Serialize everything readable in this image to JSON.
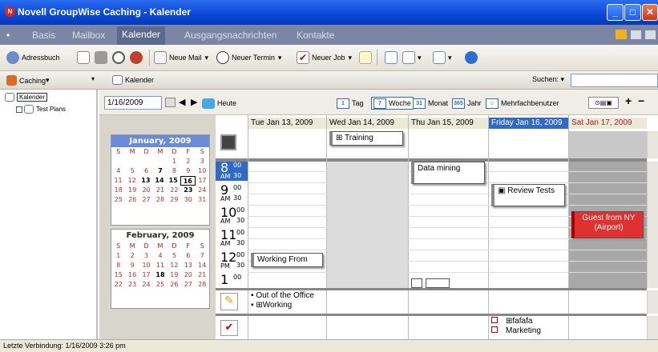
{
  "window": {
    "title": "Novell GroupWise Caching - Kalender"
  },
  "tabs": [
    {
      "label": "Basis"
    },
    {
      "label": "Mailbox"
    },
    {
      "label": "Kalender"
    },
    {
      "label": "Ausgangsnachrichten"
    },
    {
      "label": "Kontakte"
    }
  ],
  "toolbar": {
    "adressbuch": "Adressbuch",
    "neue_mail": "Neue Mail",
    "neuer_termin": "Neuer Termin",
    "neuer_job": "Neuer Job"
  },
  "subbar": {
    "caching": "Caching",
    "kalender": "Kalender",
    "suchen": "Suchen:"
  },
  "folders": {
    "root": "Kalender",
    "child": "Test Plans"
  },
  "calendar_header": {
    "date": "1/16/2009",
    "heute": "Heute",
    "views": [
      {
        "num": "1",
        "label": "Tag"
      },
      {
        "num": "7",
        "label": "Woche"
      },
      {
        "num": "31",
        "label": "Monat"
      },
      {
        "num": "365",
        "label": "Jahr"
      },
      {
        "num": "",
        "label": "Mehrfachbenutzer"
      }
    ]
  },
  "minicals": [
    {
      "month": "January, 2009",
      "dow": [
        "S",
        "M",
        "D",
        "M",
        "D",
        "F",
        "S"
      ],
      "weeks": [
        [
          "",
          "",
          "",
          "",
          "1",
          "2",
          "3"
        ],
        [
          "4",
          "5",
          "6",
          "7",
          "8",
          "9",
          "10"
        ],
        [
          "11",
          "12",
          "13",
          "14",
          "15",
          "16",
          "17"
        ],
        [
          "18",
          "19",
          "20",
          "21",
          "22",
          "23",
          "24"
        ],
        [
          "25",
          "26",
          "27",
          "28",
          "29",
          "30",
          "31"
        ]
      ]
    },
    {
      "month": "February, 2009",
      "dow": [
        "S",
        "M",
        "D",
        "M",
        "D",
        "F",
        "S"
      ],
      "weeks": [
        [
          "1",
          "2",
          "3",
          "4",
          "5",
          "6",
          "7"
        ],
        [
          "8",
          "9",
          "10",
          "11",
          "12",
          "13",
          "14"
        ],
        [
          "15",
          "16",
          "17",
          "18",
          "19",
          "20",
          "21"
        ],
        [
          "22",
          "23",
          "24",
          "25",
          "26",
          "27",
          "28"
        ]
      ]
    }
  ],
  "days": [
    {
      "label": "Tue Jan 13, 2009"
    },
    {
      "label": "Wed Jan 14, 2009"
    },
    {
      "label": "Thu Jan 15, 2009"
    },
    {
      "label": "Friday Jan 16, 2009"
    },
    {
      "label": "Sat Jan 17, 2009"
    }
  ],
  "times": [
    {
      "h": "8",
      "ap": "AM"
    },
    {
      "h": "9",
      "ap": "AM"
    },
    {
      "h": "10",
      "ap": "AM"
    },
    {
      "h": "11",
      "ap": "AM"
    },
    {
      "h": "12",
      "ap": "PM"
    },
    {
      "h": "1",
      "ap": ""
    }
  ],
  "minutes": [
    "00",
    "30"
  ],
  "appointments": {
    "training": "Training",
    "data_mining": "Data mining",
    "review_tests": "Review Tests",
    "guest": "Guest from NY (Airport)",
    "working_from": "Working From"
  },
  "notes": [
    "Out of the Office",
    "Working"
  ],
  "tasks": [
    "fafafa",
    "Marketing"
  ],
  "status": {
    "text": "Letzte Verbindung: 1/16/2009 3:26 pm"
  },
  "colors": {
    "titlebar": "#0a47d6",
    "today": "#316ac5",
    "weekend": "#b02020",
    "guest": "#e03030"
  }
}
